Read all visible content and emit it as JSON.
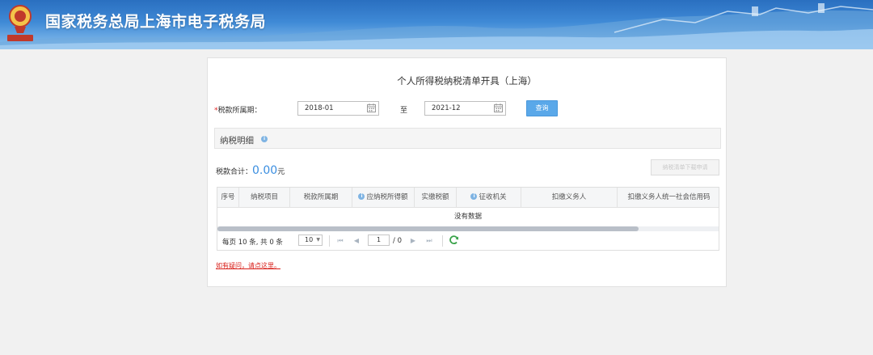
{
  "header": {
    "site_title": "国家税务总局上海市电子税务局",
    "emblem_caption": "中国税务",
    "colors": {
      "banner_top": "#2a6fc0",
      "banner_bottom": "#8fc3ef"
    }
  },
  "form": {
    "title": "个人所得税纳税清单开具（上海）",
    "period_label": "税款所属期：",
    "required_mark": "*",
    "start_date": "2018-01",
    "to_label": "至",
    "end_date": "2021-12",
    "query_button": "查询"
  },
  "details": {
    "section_title": "纳税明细",
    "total_label": "税款合计：",
    "total_value": "0.00",
    "total_unit": "元",
    "download_button": "纳税清单下载申请"
  },
  "table": {
    "columns": [
      {
        "label": "序号",
        "has_info": false
      },
      {
        "label": "纳税项目",
        "has_info": false
      },
      {
        "label": "税款所属期",
        "has_info": false
      },
      {
        "label": "应纳税所得额",
        "has_info": true
      },
      {
        "label": "实缴税额",
        "has_info": false
      },
      {
        "label": "征收机关",
        "has_info": true
      },
      {
        "label": "扣缴义务人",
        "has_info": false
      },
      {
        "label": "扣缴义务人统一社会信用码",
        "has_info": false
      }
    ],
    "empty_text": "没有数据"
  },
  "pager": {
    "summary": "每页 10 条, 共 0 条",
    "page_size": "10",
    "current_page": "1",
    "total_pages": "/ 0"
  },
  "help_link": "如有疑问，请点这里。",
  "colors": {
    "accent": "#5aa8e9",
    "total_value": "#3b8ee0",
    "link": "#d9221c",
    "required": "#e02020"
  }
}
